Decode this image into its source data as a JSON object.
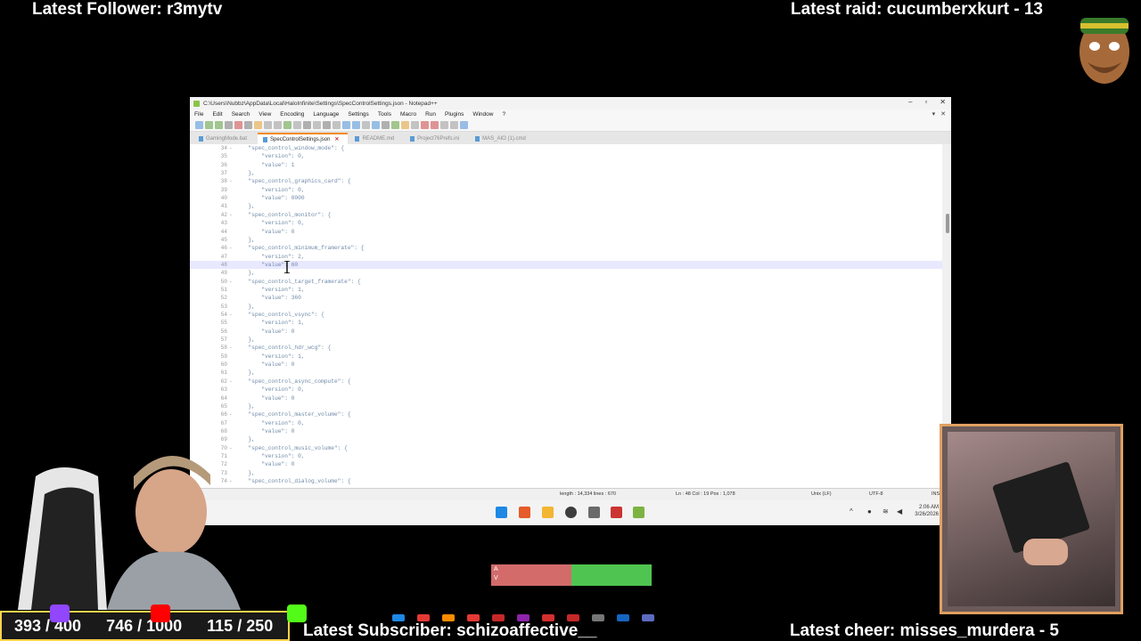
{
  "overlay": {
    "latest_follower": "Latest Follower: r3mytv",
    "latest_raid": "Latest raid: cucumberxkurt - 13",
    "latest_subscriber": "Latest Subscriber: schizoaffective__",
    "latest_cheer": "Latest cheer: misses_murdera - 5",
    "goals": [
      {
        "value": "393 / 400",
        "color": "#9146ff",
        "icon": "twitch-icon"
      },
      {
        "value": "746 / 1000",
        "color": "#ff0000",
        "icon": "youtube-icon"
      },
      {
        "value": "115 / 250",
        "color": "#53fc18",
        "icon": "kick-icon"
      }
    ],
    "hp_labels": [
      "A",
      "V"
    ]
  },
  "window": {
    "title": "C:\\Users\\Nubbz\\AppData\\Local\\HaloInfinite\\Settings\\SpecControlSettings.json - Notepad++",
    "menu": [
      "File",
      "Edit",
      "Search",
      "View",
      "Encoding",
      "Language",
      "Settings",
      "Tools",
      "Macro",
      "Run",
      "Plugins",
      "Window",
      "?"
    ],
    "tabs": [
      {
        "label": "GamingMode.bat",
        "active": false
      },
      {
        "label": "SpecControlSettings.json",
        "active": true
      },
      {
        "label": "README.md",
        "active": false
      },
      {
        "label": "Project76Prefs.ini",
        "active": false
      },
      {
        "label": "MAS_AIO (1).cmd",
        "active": false
      }
    ],
    "status": {
      "file_type": "file",
      "length_lines": "length : 14,334    lines : 670",
      "position": "Ln : 48    Col : 19    Pos : 1,078",
      "eol": "Unix (LF)",
      "encoding": "UTF-8",
      "mode": "INS"
    }
  },
  "code_lines": [
    {
      "n": "34",
      "t": "  \"spec_control_window_mode\": {",
      "fold": "-"
    },
    {
      "n": "35",
      "t": "      \"version\": 0,"
    },
    {
      "n": "36",
      "t": "      \"value\": 1"
    },
    {
      "n": "37",
      "t": "  },"
    },
    {
      "n": "38",
      "t": "  \"spec_control_graphics_card\": {",
      "fold": "-"
    },
    {
      "n": "39",
      "t": "      \"version\": 0,"
    },
    {
      "n": "40",
      "t": "      \"value\": 0000"
    },
    {
      "n": "41",
      "t": "  },"
    },
    {
      "n": "42",
      "t": "  \"spec_control_monitor\": {",
      "fold": "-"
    },
    {
      "n": "43",
      "t": "      \"version\": 0,"
    },
    {
      "n": "44",
      "t": "      \"value\": 0"
    },
    {
      "n": "45",
      "t": "  },"
    },
    {
      "n": "46",
      "t": "  \"spec_control_minimum_framerate\": {",
      "fold": "-"
    },
    {
      "n": "47",
      "t": "      \"version\": 2,"
    },
    {
      "n": "48",
      "t": "      \"value\": 60",
      "current": true
    },
    {
      "n": "49",
      "t": "  },"
    },
    {
      "n": "50",
      "t": "  \"spec_control_target_framerate\": {",
      "fold": "-"
    },
    {
      "n": "51",
      "t": "      \"version\": 1,"
    },
    {
      "n": "52",
      "t": "      \"value\": 360"
    },
    {
      "n": "53",
      "t": "  },"
    },
    {
      "n": "54",
      "t": "  \"spec_control_vsync\": {",
      "fold": "-"
    },
    {
      "n": "55",
      "t": "      \"version\": 1,"
    },
    {
      "n": "56",
      "t": "      \"value\": 0"
    },
    {
      "n": "57",
      "t": "  },"
    },
    {
      "n": "58",
      "t": "  \"spec_control_hdr_wcg\": {",
      "fold": "-"
    },
    {
      "n": "59",
      "t": "      \"version\": 1,"
    },
    {
      "n": "60",
      "t": "      \"value\": 0"
    },
    {
      "n": "61",
      "t": "  },"
    },
    {
      "n": "62",
      "t": "  \"spec_control_async_compute\": {",
      "fold": "-"
    },
    {
      "n": "63",
      "t": "      \"version\": 0,"
    },
    {
      "n": "64",
      "t": "      \"value\": 0"
    },
    {
      "n": "65",
      "t": "  },"
    },
    {
      "n": "66",
      "t": "  \"spec_control_master_volume\": {",
      "fold": "-"
    },
    {
      "n": "67",
      "t": "      \"version\": 0,"
    },
    {
      "n": "68",
      "t": "      \"value\": 0"
    },
    {
      "n": "69",
      "t": "  },"
    },
    {
      "n": "70",
      "t": "  \"spec_control_music_volume\": {",
      "fold": "-"
    },
    {
      "n": "71",
      "t": "      \"version\": 0,"
    },
    {
      "n": "72",
      "t": "      \"value\": 0"
    },
    {
      "n": "73",
      "t": "  },"
    },
    {
      "n": "74",
      "t": "  \"spec_control_dialog_volume\": {",
      "fold": "-"
    }
  ],
  "taskbar": {
    "icons": [
      "windows-start-icon",
      "brave-browser-icon",
      "file-explorer-icon",
      "chrome-icon",
      "settings-icon",
      "voicemod-icon",
      "notepadpp-icon"
    ],
    "time": "2:06 AM",
    "date": "3/26/2026"
  }
}
